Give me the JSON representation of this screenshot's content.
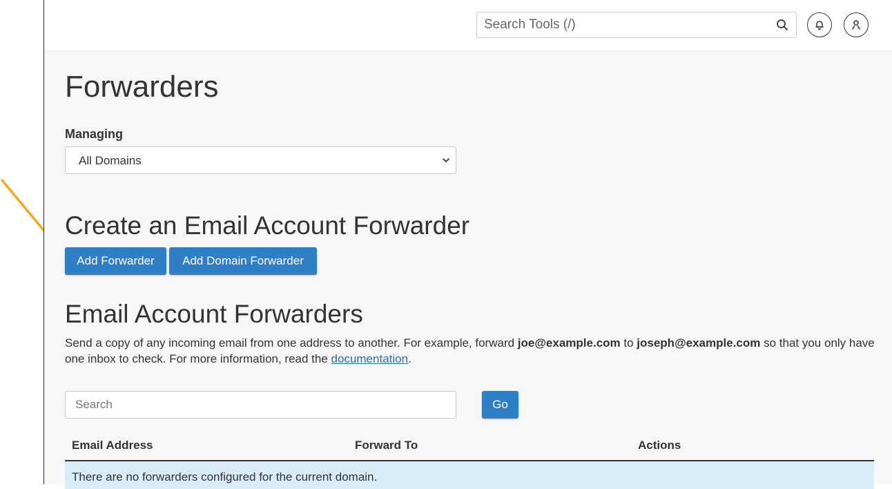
{
  "header": {
    "search_placeholder": "Search Tools (/)",
    "icons": [
      "search-icon",
      "bell-icon",
      "user-icon"
    ]
  },
  "page": {
    "title": "Forwarders"
  },
  "managing": {
    "label": "Managing",
    "selected": "All Domains"
  },
  "create_section": {
    "heading": "Create an Email Account Forwarder",
    "add_forwarder_label": "Add Forwarder",
    "add_domain_forwarder_label": "Add Domain Forwarder"
  },
  "forwarders_section": {
    "heading": "Email Account Forwarders",
    "description_part1": "Send a copy of any incoming email from one address to another. For example, forward ",
    "example_from": "joe@example.com",
    "description_part2": " to ",
    "example_to": "joseph@example.com",
    "description_part3": " so that you only have one inbox to check. For more information, read the ",
    "doc_link": "documentation",
    "description_end": "."
  },
  "search": {
    "placeholder": "Search",
    "go_label": "Go"
  },
  "table": {
    "columns": [
      "Email Address",
      "Forward To",
      "Actions"
    ],
    "empty_message": "There are no forwarders configured for the current domain."
  },
  "colors": {
    "primary_button": "#2f7fc6",
    "annotation_arrow": "#f5a623",
    "empty_row_bg": "#d9ebf7"
  }
}
